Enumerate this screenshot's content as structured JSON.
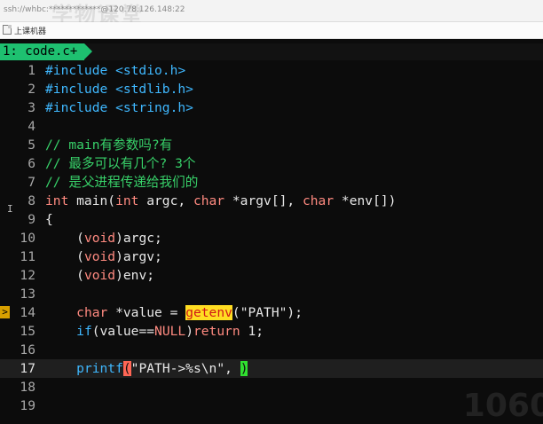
{
  "window": {
    "title": "ssh://whbc:*************@120.78.126.148:22",
    "watermark": "学物课堂"
  },
  "toolbar": {
    "session_label": "上课机器"
  },
  "tabline": {
    "tab_label": "1: code.c+"
  },
  "gutter": {
    "sign_text": ">",
    "cursor_char": "I"
  },
  "overlay": {
    "corner_text": "1060"
  },
  "colors": {
    "keyword": "#3fb8ff",
    "type": "#ff8a80",
    "comment": "#38d26a",
    "search_highlight": "#ffdd22",
    "paren_match": "#ff6655",
    "cursor": "#30e030",
    "tab_bg": "#1ec070",
    "sign": "#d8a000"
  },
  "editor": {
    "lines": [
      {
        "n": "1",
        "segs": [
          {
            "t": "#include ",
            "c": "kw"
          },
          {
            "t": "<stdio.h>",
            "c": "inc"
          }
        ]
      },
      {
        "n": "2",
        "segs": [
          {
            "t": "#include ",
            "c": "kw"
          },
          {
            "t": "<stdlib.h>",
            "c": "inc"
          }
        ]
      },
      {
        "n": "3",
        "segs": [
          {
            "t": "#include ",
            "c": "kw"
          },
          {
            "t": "<string.h>",
            "c": "inc"
          }
        ]
      },
      {
        "n": "4",
        "segs": []
      },
      {
        "n": "5",
        "segs": [
          {
            "t": "// main有参数吗?有",
            "c": "cm"
          }
        ]
      },
      {
        "n": "6",
        "segs": [
          {
            "t": "// 最多可以有几个? 3个",
            "c": "cm"
          }
        ]
      },
      {
        "n": "7",
        "segs": [
          {
            "t": "// 是父进程传递给我们的",
            "c": "cm"
          }
        ]
      },
      {
        "n": "8",
        "segs": [
          {
            "t": "int",
            "c": "typ"
          },
          {
            "t": " main("
          },
          {
            "t": "int",
            "c": "typ"
          },
          {
            "t": " argc, "
          },
          {
            "t": "char",
            "c": "typ"
          },
          {
            "t": " *argv[], "
          },
          {
            "t": "char",
            "c": "typ"
          },
          {
            "t": " *env[])"
          }
        ]
      },
      {
        "n": "9",
        "segs": [
          {
            "t": "{"
          }
        ]
      },
      {
        "n": "10",
        "segs": [
          {
            "t": "    ("
          },
          {
            "t": "void",
            "c": "typ"
          },
          {
            "t": ")argc;"
          }
        ]
      },
      {
        "n": "11",
        "segs": [
          {
            "t": "    ("
          },
          {
            "t": "void",
            "c": "typ"
          },
          {
            "t": ")argv;"
          }
        ]
      },
      {
        "n": "12",
        "segs": [
          {
            "t": "    ("
          },
          {
            "t": "void",
            "c": "typ"
          },
          {
            "t": ")env;"
          }
        ]
      },
      {
        "n": "13",
        "segs": []
      },
      {
        "n": "14",
        "sign": true,
        "segs": [
          {
            "t": "    "
          },
          {
            "t": "char",
            "c": "typ"
          },
          {
            "t": " *value = "
          },
          {
            "t": "getenv",
            "c": "hl-search"
          },
          {
            "t": "("
          },
          {
            "t": "\"PATH\"",
            "c": "str"
          },
          {
            "t": ");"
          }
        ]
      },
      {
        "n": "15",
        "segs": [
          {
            "t": "    "
          },
          {
            "t": "if",
            "c": "kw"
          },
          {
            "t": "(value=="
          },
          {
            "t": "NULL",
            "c": "typ"
          },
          {
            "t": ")"
          },
          {
            "t": "return",
            "c": "typ"
          },
          {
            "t": " "
          },
          {
            "t": "1",
            "c": "num"
          },
          {
            "t": ";"
          }
        ]
      },
      {
        "n": "16",
        "segs": []
      },
      {
        "n": "17",
        "cur": true,
        "segs": [
          {
            "t": "    "
          },
          {
            "t": "printf",
            "c": "fn"
          },
          {
            "t": "(",
            "c": "hl-paren"
          },
          {
            "t": "\"PATH->%s\\n\"",
            "c": "str"
          },
          {
            "t": ", "
          },
          {
            "t": ")",
            "c": "hl-cursor"
          }
        ]
      },
      {
        "n": "18",
        "segs": []
      },
      {
        "n": "19",
        "segs": []
      }
    ]
  }
}
